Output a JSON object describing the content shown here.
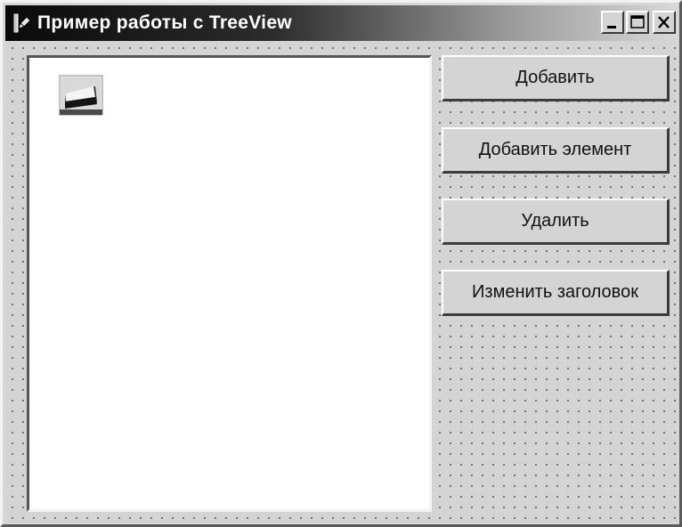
{
  "window": {
    "title": "Пример работы с TreeView",
    "app_icon": "form-icon",
    "caption_buttons": [
      "minimize-icon",
      "maximize-icon",
      "close-icon"
    ]
  },
  "treeview": {
    "nodes": [
      {
        "icon": "tree-node-icon",
        "label": ""
      }
    ]
  },
  "buttons": {
    "add": "Добавить",
    "add_item": "Добавить элемент",
    "delete": "Удалить",
    "rename": "Изменить заголовок"
  }
}
